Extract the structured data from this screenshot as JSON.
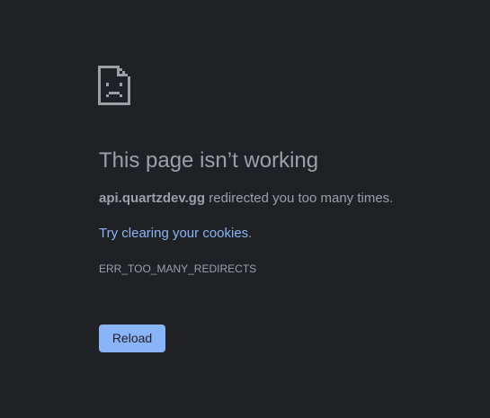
{
  "error": {
    "icon": "sad-page-icon",
    "heading": "This page isn’t working",
    "summary_host": "api.quartzdev.gg",
    "summary_text": " redirected you too many times.",
    "suggestion_prefix": "",
    "suggestion_link": "Try clearing your cookies",
    "suggestion_suffix": ".",
    "code": "ERR_TOO_MANY_REDIRECTS"
  },
  "actions": {
    "reload_label": "Reload"
  },
  "colors": {
    "background": "#202124",
    "text": "#9aa0a6",
    "link": "#8ab4f8",
    "button_bg": "#8ab4f8",
    "button_text": "#202124"
  }
}
